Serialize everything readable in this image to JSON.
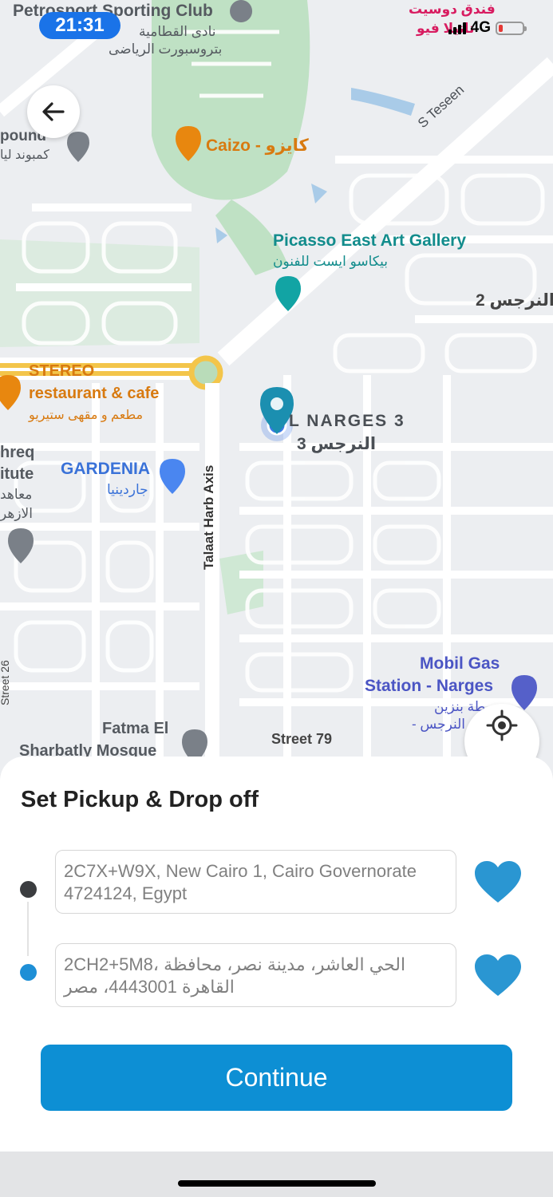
{
  "status": {
    "time": "21:31",
    "network": "4G"
  },
  "map": {
    "labels": {
      "petrosport_en": "Petrosport Sporting Club",
      "petrosport_ar1": "نادى القطامية",
      "petrosport_ar2": "بتروسبورت الرياضى",
      "compound_en": "pound",
      "compound_ar": "كمبوند ليا",
      "caizo": "Caizo - كايزو",
      "s_teseen": "S Teseen",
      "picasso_en": "Picasso East Art Gallery",
      "picasso_ar": "بيكاسو ايست للفنون",
      "narges2": "النرجس 2",
      "stereo1": "STEREO",
      "stereo2": "restaurant & cafe",
      "stereo_ar": "مطعم و مقهى ستيريو",
      "narges3_en": "L NARGES 3",
      "narges3_ar": "النرجس 3",
      "shreq1": "hreq",
      "shreq2": "itute",
      "shreq3": "معاهد",
      "shreq4": "الازهر",
      "gardenia_en": "GARDENIA",
      "gardenia_ar": "جاردينيا",
      "talaat": "Talaat Harb Axis",
      "mobil1": "Mobil Gas",
      "mobil2": "Station - Narges",
      "mobil_ar1": "طة بنزين",
      "mobil_ar2": "- النرجس",
      "fatma1": "Fatma El",
      "fatma2": "Sharbatly Mosque",
      "street79": "Street 79",
      "street26": "Street 26",
      "hotel_ar1": "فندق دوسيت",
      "hotel_ar2": "تانيلا فيو"
    },
    "colors": {
      "pin": "#1b8fb0",
      "location_dot": "#3b78e7"
    }
  },
  "back_button": {
    "icon": "arrow-left-icon"
  },
  "locate_button": {
    "icon": "crosshair-icon"
  },
  "sheet": {
    "title": "Set Pickup & Drop off",
    "pickup": {
      "value": "2C7X+W9X, New Cairo 1, Cairo Governorate 4724124, Egypt"
    },
    "dropoff": {
      "value": "2CH2+5M8، الحي العاشر، مدينة نصر، محافظة القاهرة 4443001، مصر"
    },
    "favorite_icon": "heart-icon",
    "continue_label": "Continue",
    "colors": {
      "accent": "#0d8fd4",
      "pickup_dot": "#3b3d40",
      "dropoff_dot": "#1e8fd6"
    }
  }
}
